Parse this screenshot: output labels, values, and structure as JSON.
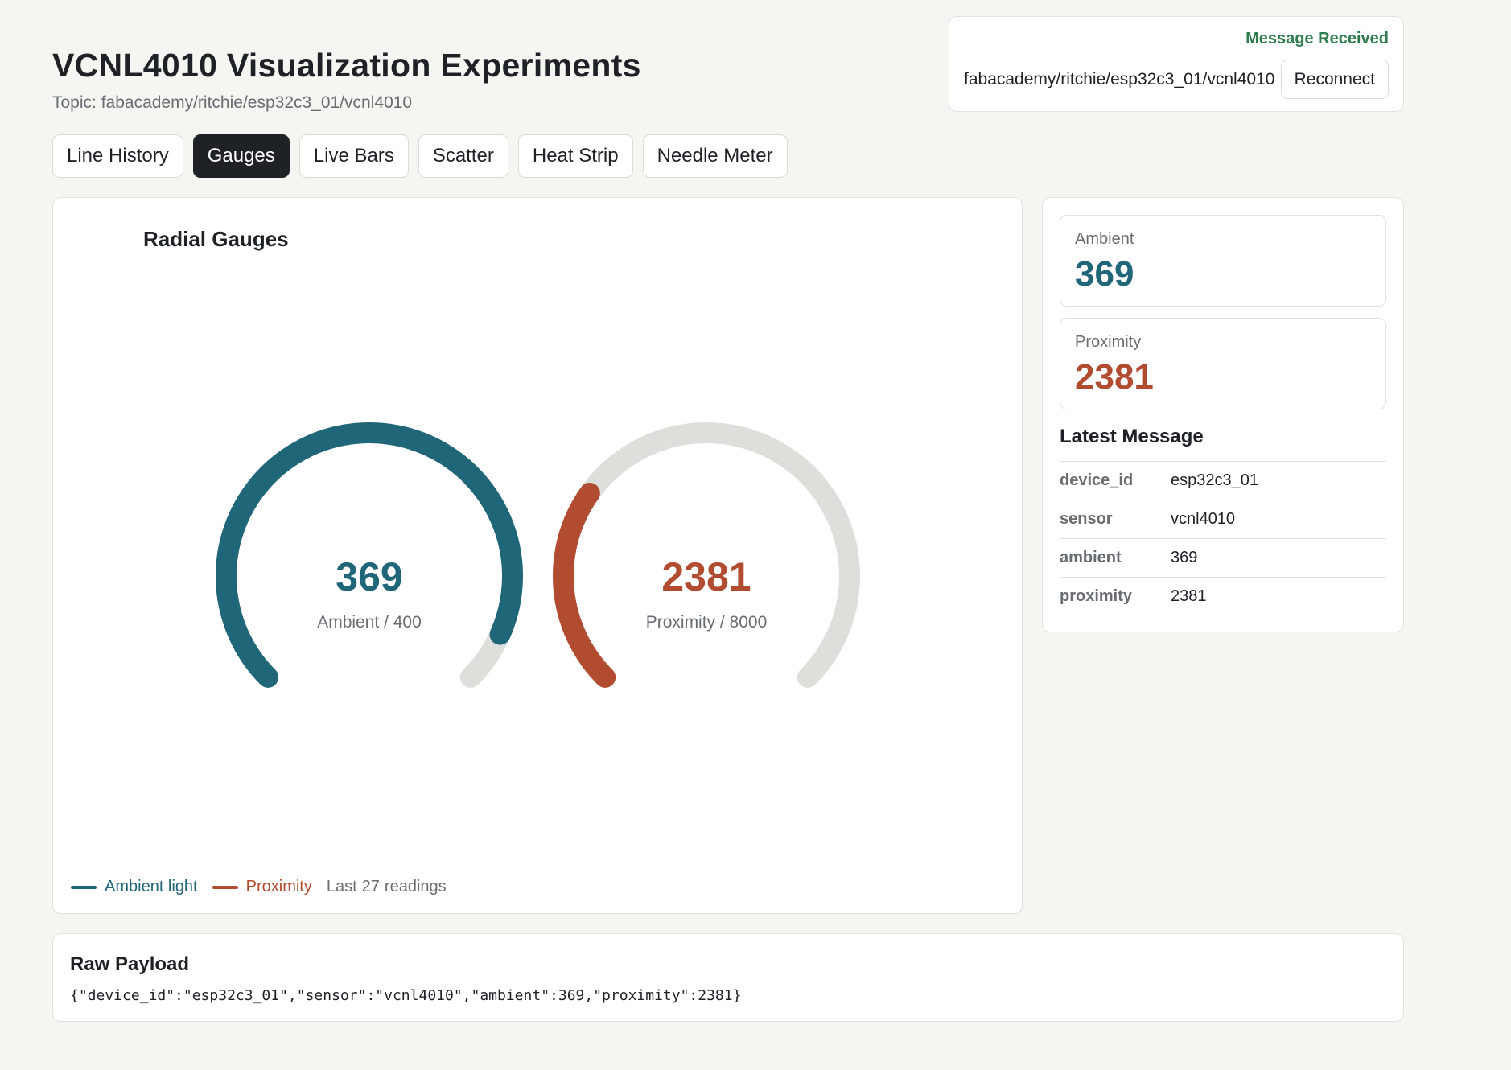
{
  "header": {
    "title": "VCNL4010 Visualization Experiments",
    "topic": "Topic: fabacademy/ritchie/esp32c3_01/vcnl4010"
  },
  "connection": {
    "status": "Message Received",
    "topic": "fabacademy/ritchie/esp32c3_01/vcnl4010",
    "reconnect_label": "Reconnect"
  },
  "tabs": [
    {
      "label": "Line History",
      "active": false
    },
    {
      "label": "Gauges",
      "active": true
    },
    {
      "label": "Live Bars",
      "active": false
    },
    {
      "label": "Scatter",
      "active": false
    },
    {
      "label": "Heat Strip",
      "active": false
    },
    {
      "label": "Needle Meter",
      "active": false
    }
  ],
  "chart_data": {
    "type": "gauge",
    "title": "Radial Gauges",
    "sweep_degrees": 270,
    "gauges": [
      {
        "name": "Ambient",
        "value": 369,
        "max": 400,
        "value_label": "369",
        "caption": "Ambient / 400",
        "color": "#1f6678"
      },
      {
        "name": "Proximity",
        "value": 2381,
        "max": 8000,
        "value_label": "2381",
        "caption": "Proximity / 8000",
        "color": "#b24c30"
      }
    ],
    "track_color": "#dcdfda",
    "legend": {
      "items": [
        {
          "label": "Ambient light",
          "color": "#1f6678"
        },
        {
          "label": "Proximity",
          "color": "#b24c30"
        }
      ],
      "count_prefix": "Last",
      "count": "27",
      "count_suffix": "readings"
    }
  },
  "stats": [
    {
      "label": "Ambient",
      "value": "369",
      "color": "#1f6678"
    },
    {
      "label": "Proximity",
      "value": "2381",
      "color": "#b24c30"
    }
  ],
  "latest_message": {
    "title": "Latest Message",
    "rows": [
      {
        "key": "device_id",
        "value": "esp32c3_01"
      },
      {
        "key": "sensor",
        "value": "vcnl4010"
      },
      {
        "key": "ambient",
        "value": "369"
      },
      {
        "key": "proximity",
        "value": "2381"
      }
    ]
  },
  "raw": {
    "title": "Raw Payload",
    "payload": "{\"device_id\":\"esp32c3_01\",\"sensor\":\"vcnl4010\",\"ambient\":369,\"proximity\":2381}"
  }
}
